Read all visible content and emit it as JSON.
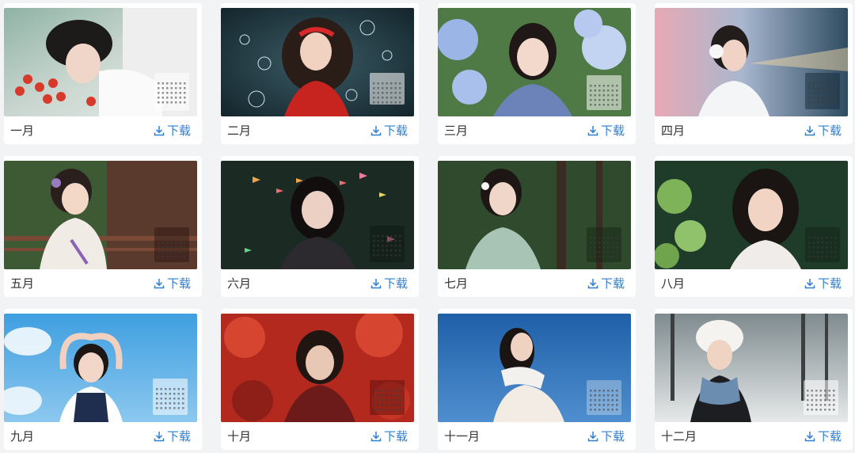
{
  "download_label": "下载",
  "accent_color": "#2f7fd1",
  "cards": [
    {
      "month": "一月",
      "photo": "woman-lying-with-tomatoes-photo"
    },
    {
      "month": "二月",
      "photo": "woman-red-headband-bubbles-photo"
    },
    {
      "month": "三月",
      "photo": "woman-blue-hydrangea-photo"
    },
    {
      "month": "四月",
      "photo": "woman-white-headphones-photo"
    },
    {
      "month": "五月",
      "photo": "woman-qipao-balcony-photo"
    },
    {
      "month": "六月",
      "photo": "woman-aquarium-fish-photo"
    },
    {
      "month": "七月",
      "photo": "woman-green-qipao-forest-photo"
    },
    {
      "month": "八月",
      "photo": "woman-green-leaves-photo"
    },
    {
      "month": "九月",
      "photo": "woman-heart-hands-sky-photo"
    },
    {
      "month": "十月",
      "photo": "woman-red-maple-leaves-photo"
    },
    {
      "month": "十一月",
      "photo": "woman-scarf-blue-sky-photo"
    },
    {
      "month": "十二月",
      "photo": "woman-white-hat-snow-photo"
    }
  ]
}
